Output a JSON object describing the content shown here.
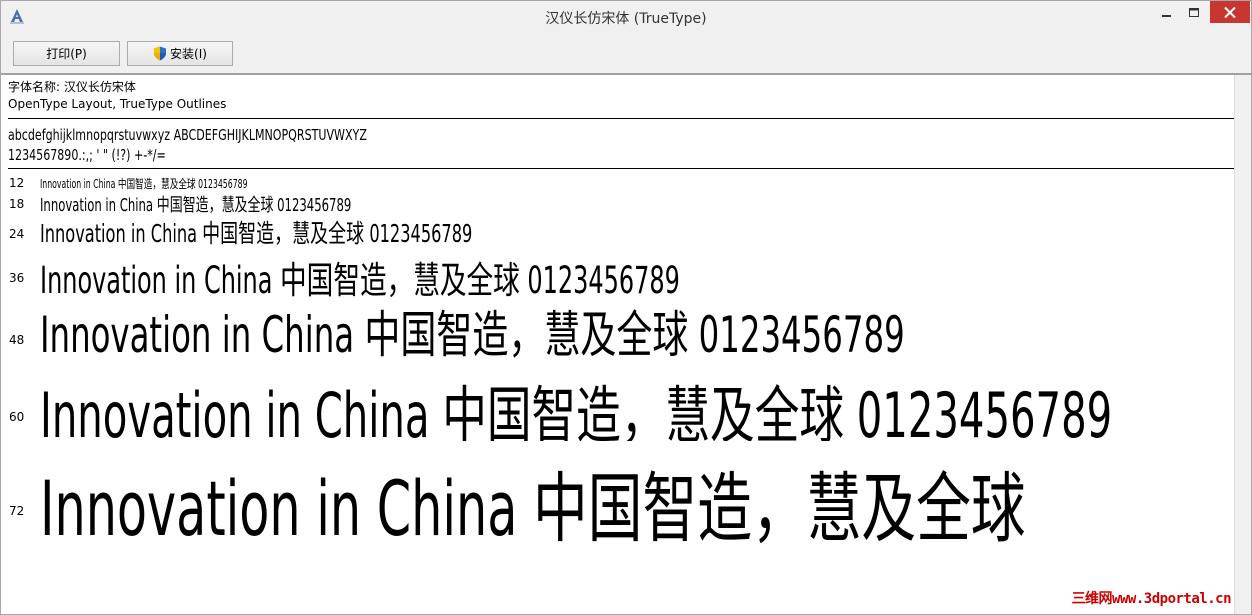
{
  "window": {
    "title": "汉仪长仿宋体 (TrueType)"
  },
  "toolbar": {
    "print_label": "打印(P)",
    "install_label": "安装(I)"
  },
  "font_info": {
    "name_line": "字体名称: 汉仪长仿宋体",
    "type_line": "OpenType Layout, TrueType Outlines"
  },
  "charset": {
    "line1": "abcdefghijklmnopqrstuvwxyz ABCDEFGHIJKLMNOPQRSTUVWXYZ",
    "line2": "1234567890.:,; ' \" (!?) +-*/="
  },
  "samples": [
    {
      "size": "12",
      "text": "Innovation in China 中国智造，慧及全球 0123456789"
    },
    {
      "size": "18",
      "text": "Innovation in China 中国智造，慧及全球 0123456789"
    },
    {
      "size": "24",
      "text": "Innovation in China 中国智造，慧及全球 0123456789"
    },
    {
      "size": "36",
      "text": "Innovation in China 中国智造，慧及全球 0123456789"
    },
    {
      "size": "48",
      "text": "Innovation in China 中国智造，慧及全球 0123456789"
    },
    {
      "size": "60",
      "text": "Innovation in China 中国智造，慧及全球 0123456789"
    },
    {
      "size": "72",
      "text": "Innovation in China 中国智造，慧及全球"
    }
  ],
  "watermark": "三维网www.3dportal.cn",
  "colors": {
    "close_button": "#c7372f",
    "watermark": "#cc0000"
  }
}
